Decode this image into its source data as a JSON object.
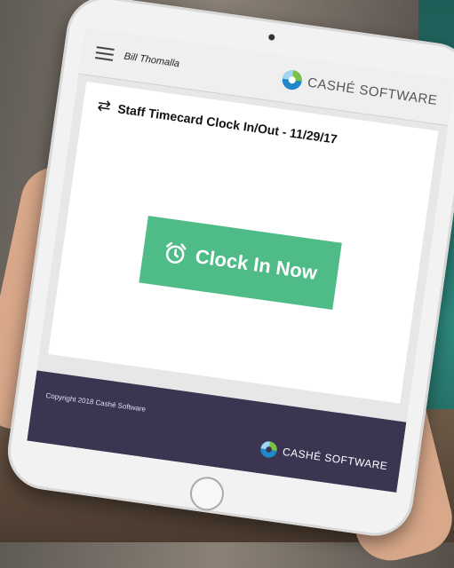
{
  "header": {
    "user_name": "Bill Thomalla",
    "brand_name": "CASHÉ SOFTWARE"
  },
  "main": {
    "page_title": "Staff Timecard Clock In/Out - 11/29/17",
    "clock_button_label": "Clock In Now"
  },
  "footer": {
    "copyright": "Copyright 2018 Cashé Software",
    "brand_name": "CASHÉ SOFTWARE"
  },
  "colors": {
    "accent_green": "#4fbb86",
    "footer_purple": "#3c3552",
    "logo_green": "#7cc242",
    "logo_blue": "#1e88c8"
  },
  "icons": [
    "hamburger-menu-icon",
    "swap-arrows-icon",
    "alarm-clock-icon",
    "cashe-logo-icon"
  ]
}
